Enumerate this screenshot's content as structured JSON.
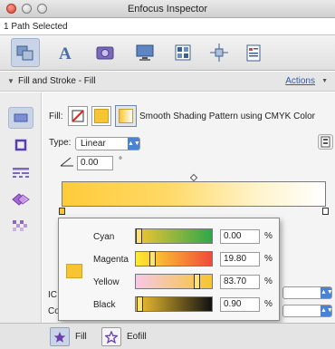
{
  "window": {
    "title": "Enfocus Inspector"
  },
  "selection_status": "1 Path Selected",
  "toolbar": {
    "icons": [
      "path-icon",
      "text-icon",
      "image-icon",
      "monitor-icon",
      "layout-grid-icon",
      "position-icon",
      "document-list-icon"
    ]
  },
  "section": {
    "title": "Fill and Stroke - Fill",
    "actions_label": "Actions"
  },
  "fill": {
    "label": "Fill:",
    "description": "Smooth Shading Pattern using CMYK Color",
    "type_label": "Type:",
    "type_value": "Linear",
    "angle_value": "0.00",
    "angle_unit": "°"
  },
  "color_popover": {
    "channels": [
      {
        "name": "Cyan",
        "value": "0.00",
        "unit": "%",
        "level": 0.0
      },
      {
        "name": "Magenta",
        "value": "19.80",
        "unit": "%",
        "level": 0.198
      },
      {
        "name": "Yellow",
        "value": "83.70",
        "unit": "%",
        "level": 0.837
      },
      {
        "name": "Black",
        "value": "0.90",
        "unit": "%",
        "level": 0.009
      }
    ]
  },
  "partial_labels": [
    "IC",
    "Co"
  ],
  "bottom_tabs": {
    "fill_label": "Fill",
    "eofill_label": "Eofill"
  },
  "colors": {
    "accent": "#4a82d4",
    "swatch": "#f7c531"
  }
}
